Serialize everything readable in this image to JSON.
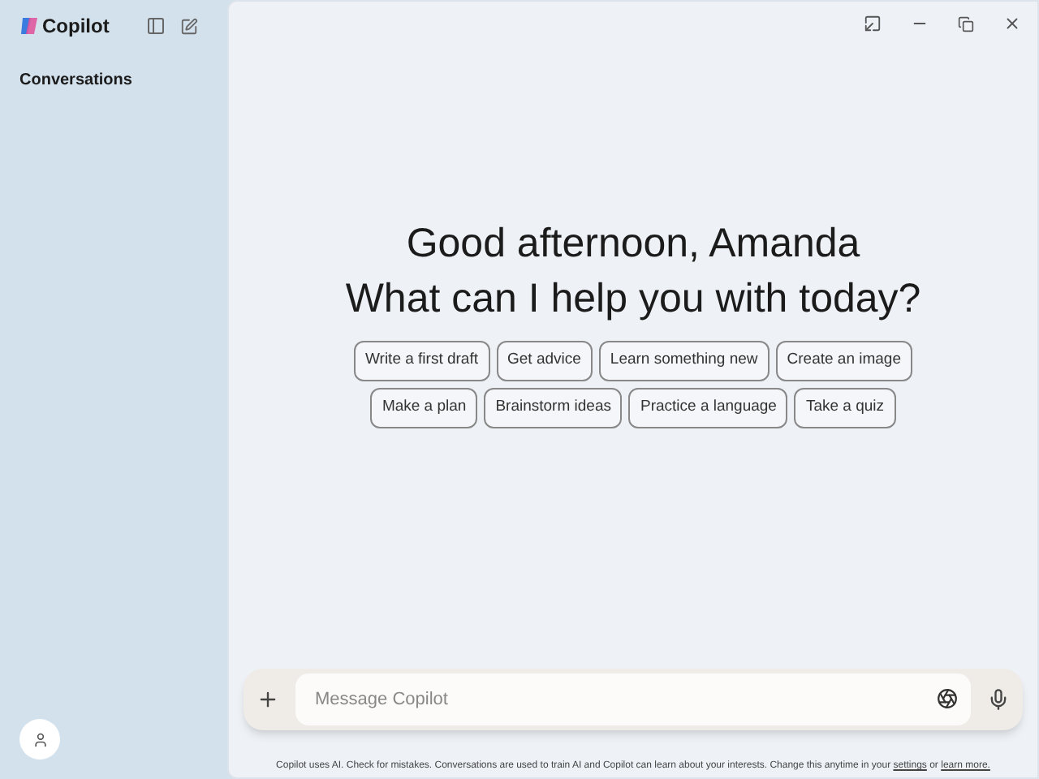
{
  "sidebar": {
    "app_name": "Copilot",
    "heading": "Conversations"
  },
  "greeting": [
    "Good afternoon, Amanda",
    "What can I help you with today?"
  ],
  "suggestion_rows": [
    [
      "Write a first draft",
      "Get advice",
      "Learn something new",
      "Create an image"
    ],
    [
      "Make a plan",
      "Brainstorm ideas",
      "Practice a language",
      "Take a quiz"
    ]
  ],
  "composer": {
    "placeholder": "Message Copilot"
  },
  "disclaimer": {
    "text": "Copilot uses AI. Check for mistakes. Conversations are used to train AI and Copilot can learn about your interests. Change this anytime in your",
    "link": "settings",
    "joiner": "or",
    "link_2": "learn more."
  }
}
